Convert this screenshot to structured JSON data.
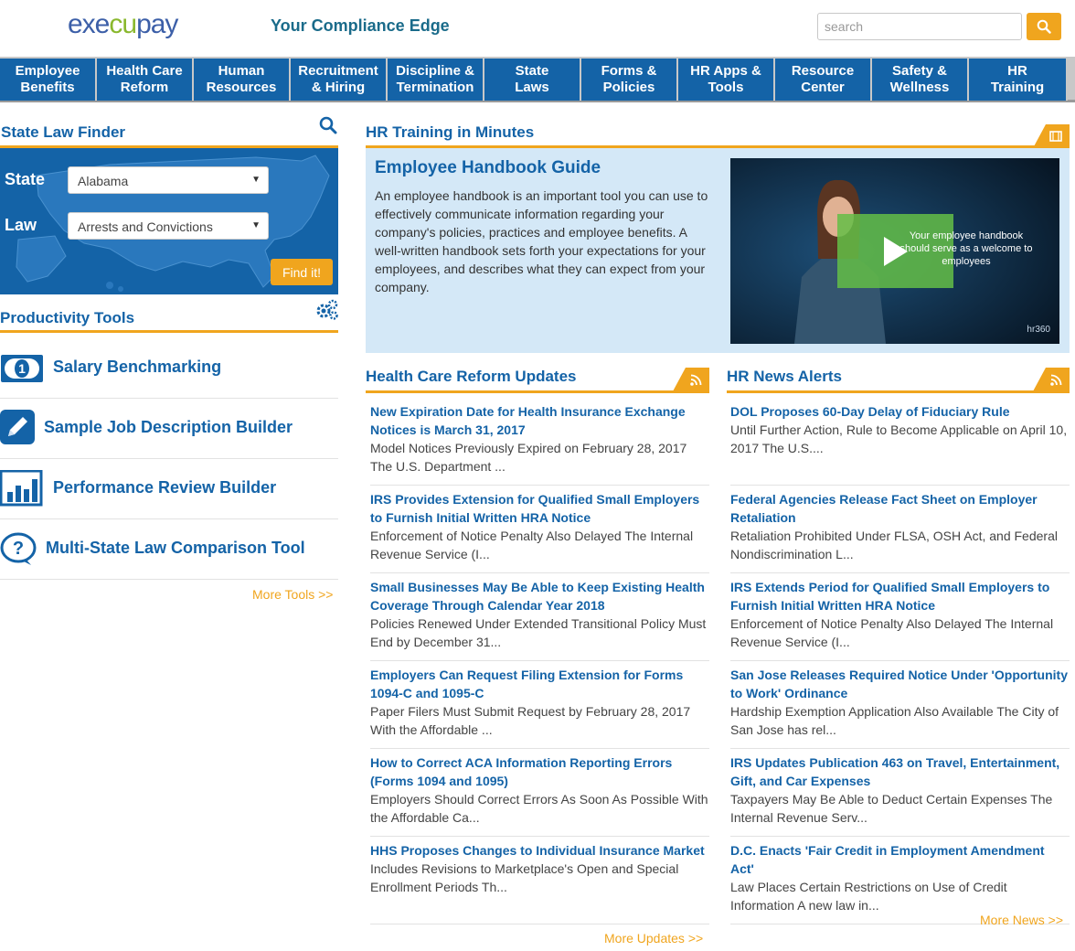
{
  "header": {
    "logo_part1": "exe",
    "logo_part2": "cu",
    "logo_part3": "pay",
    "tagline": "Your Compliance Edge",
    "search_placeholder": "search"
  },
  "nav": [
    {
      "label": "Employee\nBenefits",
      "w": 106
    },
    {
      "label": "Health Care\nReform",
      "w": 106
    },
    {
      "label": "Human\nResources",
      "w": 106
    },
    {
      "label": "Recruitment\n& Hiring",
      "w": 106
    },
    {
      "label": "Discipline &\nTermination",
      "w": 106
    },
    {
      "label": "State\nLaws",
      "w": 106
    },
    {
      "label": "Forms &\nPolicies",
      "w": 106
    },
    {
      "label": "HR Apps &\nTools",
      "w": 106
    },
    {
      "label": "Resource\nCenter",
      "w": 106
    },
    {
      "label": "Safety &\nWellness",
      "w": 106
    },
    {
      "label": "HR\nTraining",
      "w": 108
    }
  ],
  "state_law_finder": {
    "title": "State Law Finder",
    "state_label": "State",
    "state_value": "Alabama",
    "law_label": "Law",
    "law_value": "Arrests and Convictions",
    "button": "Find it!"
  },
  "productivity": {
    "title": "Productivity Tools",
    "tools": [
      {
        "label": "Salary Benchmarking"
      },
      {
        "label": "Sample Job Description Builder"
      },
      {
        "label": "Performance Review Builder"
      },
      {
        "label": "Multi-State Law Comparison Tool"
      }
    ],
    "more": "More Tools >>"
  },
  "training": {
    "title": "HR Training in Minutes",
    "heading": "Employee Handbook Guide",
    "body": "An employee handbook is an important tool you can use to effectively communicate information regarding your company's policies, practices and employee benefits. A well-written handbook sets forth your expectations for your employees, and describes what they can expect from your company.",
    "video_caption": "Your employee handbook should serve as a welcome to employees",
    "video_logo": "hr360"
  },
  "hcr": {
    "title": "Health Care Reform Updates",
    "items": [
      {
        "title": "New Expiration Date for Health Insurance Exchange Notices is March 31, 2017",
        "desc": "Model Notices Previously Expired on February 28, 2017 The U.S. Department ..."
      },
      {
        "title": "IRS Provides Extension for Qualified Small Employers to Furnish Initial Written HRA Notice",
        "desc": "Enforcement of Notice Penalty Also Delayed The Internal Revenue Service (I..."
      },
      {
        "title": "Small Businesses May Be Able to Keep Existing Health Coverage Through Calendar Year 2018",
        "desc": "Policies Renewed Under Extended Transitional Policy Must End by December 31..."
      },
      {
        "title": "Employers Can Request Filing Extension for Forms 1094-C and 1095-C",
        "desc": "Paper Filers Must Submit Request by February 28, 2017 With the Affordable ..."
      },
      {
        "title": "How to Correct ACA Information Reporting Errors (Forms 1094 and 1095)",
        "desc": "Employers Should Correct Errors As Soon As Possible With the Affordable Ca..."
      },
      {
        "title": "HHS Proposes Changes to Individual Insurance Market",
        "desc": "Includes Revisions to Marketplace's Open and Special Enrollment Periods Th..."
      }
    ],
    "more": "More Updates >>"
  },
  "news": {
    "title": "HR News Alerts",
    "items": [
      {
        "title": "DOL Proposes 60-Day Delay of Fiduciary Rule",
        "desc": "Until Further Action, Rule to Become Applicable on April 10, 2017 The U.S...."
      },
      {
        "title": "Federal Agencies Release Fact Sheet on Employer Retaliation",
        "desc": "Retaliation Prohibited Under FLSA, OSH Act, and Federal Nondiscrimination L..."
      },
      {
        "title": "IRS Extends Period for Qualified Small Employers to Furnish Initial Written HRA Notice",
        "desc": "Enforcement of Notice Penalty Also Delayed The Internal Revenue Service (I..."
      },
      {
        "title": "San Jose Releases Required Notice Under 'Opportunity to Work' Ordinance",
        "desc": "Hardship Exemption Application Also Available The City of San Jose has rel..."
      },
      {
        "title": "IRS Updates Publication 463 on Travel, Entertainment, Gift, and Car Expenses",
        "desc": "Taxpayers May Be Able to Deduct Certain Expenses The Internal Revenue Serv..."
      },
      {
        "title": "D.C. Enacts 'Fair Credit in Employment Amendment Act'",
        "desc": "Law Places Certain Restrictions on Use of Credit Information A new law in..."
      }
    ],
    "more": "More News >>"
  },
  "colors": {
    "brand_blue": "#1463a7",
    "accent_orange": "#f0a51e",
    "panel_blue": "#d4e8f7"
  }
}
